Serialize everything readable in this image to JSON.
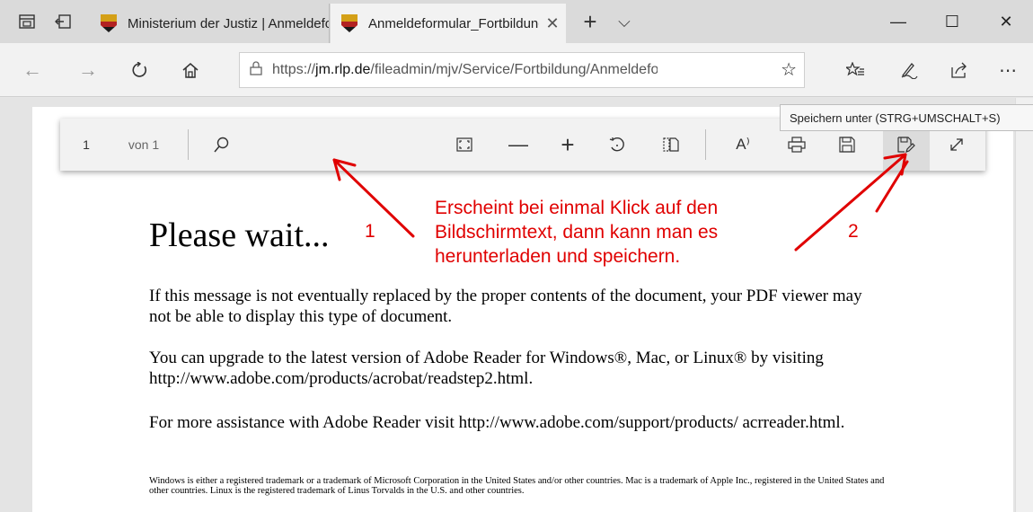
{
  "tabs": [
    {
      "label": "Ministerium der Justiz | Anmeldeformular"
    },
    {
      "label": "Anmeldeformular_Fortbildung",
      "close": "✕"
    }
  ],
  "new_tab": "+",
  "tab_list": "⌵",
  "window": {
    "minimize": "—",
    "maximize": "☐",
    "close": "✕"
  },
  "address": {
    "scheme": "https://",
    "host": "jm.rlp.de",
    "path": "/fileadmin/mjv/Service/Fortbildung/Anmeldeformular"
  },
  "tooltip": "Speichern unter (STRG+UMSCHALT+S)",
  "pdf_toolbar": {
    "page": "1",
    "of_label": "von 1"
  },
  "document": {
    "heading": "Please wait...",
    "p1": "If this message is not eventually replaced by the proper contents of the document, your PDF viewer may not be able to display this type of document.",
    "p2": "You can upgrade to the latest version of Adobe Reader for Windows®, Mac, or Linux® by visiting  http://www.adobe.com/products/acrobat/readstep2.html.",
    "p3": "For more assistance with Adobe Reader visit  http://www.adobe.com/support/products/ acrreader.html.",
    "fine": "Windows is either a registered trademark or a trademark of Microsoft Corporation in the United States and/or other countries. Mac is a trademark of Apple Inc., registered in the United States and other countries. Linux is the registered trademark of Linus Torvalds in the U.S. and other countries."
  },
  "annotation": {
    "label1": "1",
    "label2": "2",
    "line1": "Erscheint bei einmal Klick auf den",
    "line2": "Bildschirmtext, dann kann man es",
    "line3": "herunterladen und speichern.",
    "color": "#e00000"
  }
}
